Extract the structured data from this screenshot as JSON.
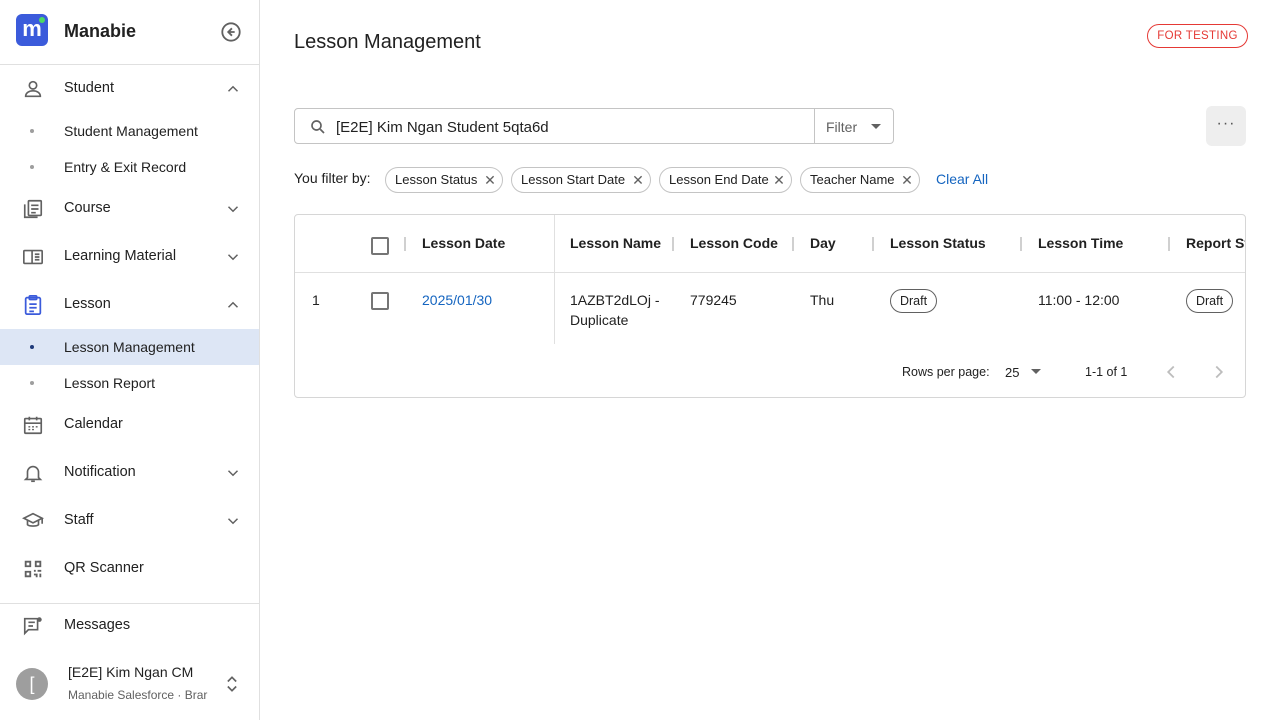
{
  "sidebar": {
    "brand": {
      "logo_letter": "m",
      "name": "Manabie"
    },
    "items": [
      {
        "label": "Student",
        "icon": "person-icon",
        "expanded": true,
        "children": [
          {
            "label": "Student Management"
          },
          {
            "label": "Entry & Exit Record"
          }
        ]
      },
      {
        "label": "Course",
        "icon": "course-icon",
        "expanded": false
      },
      {
        "label": "Learning Material",
        "icon": "book-icon",
        "expanded": false
      },
      {
        "label": "Lesson",
        "icon": "clipboard-icon",
        "expanded": true,
        "active": true,
        "children": [
          {
            "label": "Lesson Management",
            "active": true
          },
          {
            "label": "Lesson Report"
          }
        ]
      },
      {
        "label": "Calendar",
        "icon": "calendar-icon"
      },
      {
        "label": "Notification",
        "icon": "bell-icon",
        "expanded": false
      },
      {
        "label": "Staff",
        "icon": "school-icon",
        "expanded": false
      },
      {
        "label": "QR Scanner",
        "icon": "qr-icon"
      }
    ],
    "messages_label": "Messages",
    "user": {
      "avatar_letter": "[",
      "name": "[E2E] Kim Ngan CM",
      "org": "Manabie Salesforce · Brar"
    }
  },
  "header": {
    "title": "Lesson Management",
    "badge": "FOR TESTING"
  },
  "toolbar": {
    "search_value": "[E2E] Kim Ngan Student 5qta6d",
    "filter_label": "Filter",
    "more_label": "···"
  },
  "filters": {
    "label": "You filter by:",
    "chips": [
      "Lesson Status",
      "Lesson Start Date",
      "Lesson End Date",
      "Teacher Name"
    ],
    "clear_label": "Clear All"
  },
  "table": {
    "columns": [
      "Lesson Date",
      "Lesson Name",
      "Lesson Code",
      "Day",
      "Lesson Status",
      "Lesson Time",
      "Report St"
    ],
    "rows": [
      {
        "index": "1",
        "date": "2025/01/30",
        "name_line1": "1AZBT2dLOj -",
        "name_line2": "Duplicate",
        "code": "779245",
        "day": "Thu",
        "status": "Draft",
        "time": "11:00 - 12:00",
        "report_status": "Draft"
      }
    ],
    "pagination": {
      "rows_per_page_label": "Rows per page:",
      "rows_per_page": "25",
      "range": "1-1 of 1"
    }
  },
  "colors": {
    "accent": "#3b5bdb",
    "link": "#1565c0",
    "test_badge": "#e53935",
    "active_bg": "#dde6f5"
  }
}
